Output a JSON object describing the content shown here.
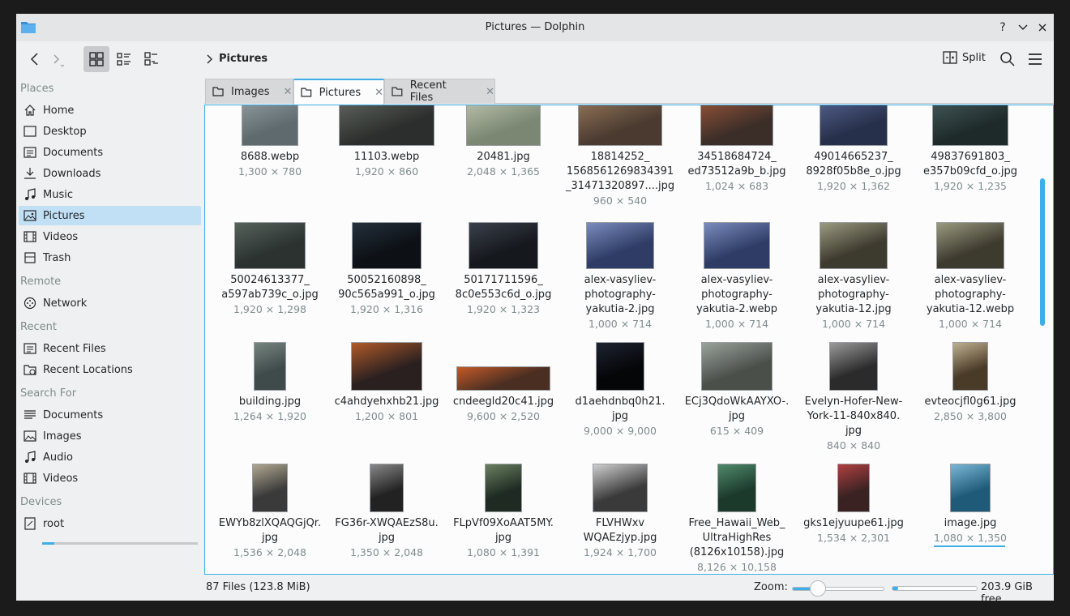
{
  "window": {
    "title": "Pictures — Dolphin",
    "help": "?",
    "minimize": "⌄",
    "close": "✕"
  },
  "toolbar": {
    "breadcrumb": "Pictures",
    "split_label": "Split"
  },
  "sidebar": {
    "sections": {
      "places": "Places",
      "remote": "Remote",
      "recent": "Recent",
      "search": "Search For",
      "devices": "Devices"
    },
    "places": [
      "Home",
      "Desktop",
      "Documents",
      "Downloads",
      "Music",
      "Pictures",
      "Videos",
      "Trash"
    ],
    "remote": [
      "Network"
    ],
    "recent": [
      "Recent Files",
      "Recent Locations"
    ],
    "search": [
      "Documents",
      "Images",
      "Audio",
      "Videos"
    ],
    "devices": [
      "root"
    ],
    "selected": "Pictures",
    "root_usage_fraction": 0.08
  },
  "tabs": [
    {
      "label": "Images",
      "active": false
    },
    {
      "label": "Pictures",
      "active": true
    },
    {
      "label": "Recent Files",
      "active": false
    }
  ],
  "files": [
    {
      "name": [
        "8688.webp"
      ],
      "dim": "1,300 × 780"
    },
    {
      "name": [
        "11103.webp"
      ],
      "dim": "1,920 × 860"
    },
    {
      "name": [
        "20481.jpg"
      ],
      "dim": "2,048 × 1,365"
    },
    {
      "name": [
        "18814252_",
        "1568561269834391",
        "_31471320897....jpg"
      ],
      "dim": "960 × 540"
    },
    {
      "name": [
        "34518684724_",
        "ed73512a9b_b.jpg"
      ],
      "dim": "1,024 × 683"
    },
    {
      "name": [
        "49014665237_",
        "8928f05b8e_o.jpg"
      ],
      "dim": "1,920 × 1,362"
    },
    {
      "name": [
        "49837691803_",
        "e357b09cfd_o.jpg"
      ],
      "dim": "1,920 × 1,235"
    },
    {
      "name": [
        "50024613377_",
        "a597ab739c_o.jpg"
      ],
      "dim": "1,920 × 1,298"
    },
    {
      "name": [
        "50052160898_",
        "90c565a991_o.jpg"
      ],
      "dim": "1,920 × 1,316"
    },
    {
      "name": [
        "50171711596_",
        "8c0e553c6d_o.jpg"
      ],
      "dim": "1,920 × 1,323"
    },
    {
      "name": [
        "alex-vasyliev-",
        "photography-",
        "yakutia-2.jpg"
      ],
      "dim": "1,000 × 714"
    },
    {
      "name": [
        "alex-vasyliev-",
        "photography-",
        "yakutia-2.webp"
      ],
      "dim": "1,000 × 714"
    },
    {
      "name": [
        "alex-vasyliev-",
        "photography-",
        "yakutia-12.jpg"
      ],
      "dim": "1,000 × 714"
    },
    {
      "name": [
        "alex-vasyliev-",
        "photography-",
        "yakutia-12.webp"
      ],
      "dim": "1,000 × 714"
    },
    {
      "name": [
        "building.jpg"
      ],
      "dim": "1,264 × 1,920"
    },
    {
      "name": [
        "c4ahdyehxhb21.jpg"
      ],
      "dim": "1,200 × 801"
    },
    {
      "name": [
        "cndeegld20c41.jpg"
      ],
      "dim": "9,600 × 2,520"
    },
    {
      "name": [
        "d1aehdnbq0h21.",
        "jpg"
      ],
      "dim": "9,000 × 9,000"
    },
    {
      "name": [
        "ECj3QdoWkAAYXO-.",
        "jpg"
      ],
      "dim": "615 × 409"
    },
    {
      "name": [
        "Evelyn-Hofer-New-",
        "York-11-840x840.",
        "jpg"
      ],
      "dim": "840 × 840"
    },
    {
      "name": [
        "evteocjfl0g61.jpg"
      ],
      "dim": "2,850 × 3,800"
    },
    {
      "name": [
        "EWYb8zlXQAQGjQr.",
        "jpg"
      ],
      "dim": "1,536 × 2,048"
    },
    {
      "name": [
        "FG36r-XWQAEzS8u.",
        "jpg"
      ],
      "dim": "1,350 × 2,048"
    },
    {
      "name": [
        "FLpVf09XoAAT5MY.",
        "jpg"
      ],
      "dim": "1,080 × 1,391"
    },
    {
      "name": [
        "FLVHWxv",
        "WQAEzjyp.jpg"
      ],
      "dim": "1,924 × 1,700"
    },
    {
      "name": [
        "Free_Hawaii_Web_",
        "UltraHighRes",
        "(8126x10158).jpg"
      ],
      "dim": "8,126 × 10,158"
    },
    {
      "name": [
        "gks1ejyuupe61.jpg"
      ],
      "dim": "1,534 × 2,301"
    },
    {
      "name": [
        "image.jpg"
      ],
      "dim": "1,080 × 1,350"
    }
  ],
  "status": {
    "summary": "87 Files (123.8 MiB)",
    "zoom_label": "Zoom:",
    "zoom_fraction": 0.28,
    "free": "203.9 GiB free",
    "used_fraction": 0.07
  },
  "icons": [
    "folder-icon",
    "back-arrow-icon",
    "forward-arrow-icon",
    "icons-view-icon",
    "details-view-icon",
    "compact-view-icon",
    "split-view-icon",
    "search-icon",
    "hamburger-menu-icon"
  ],
  "colors": {
    "accent": "#3daee9",
    "selection": "#c2e0f5",
    "window_bg": "#eff0f1",
    "view_bg": "#fcfcfc"
  }
}
